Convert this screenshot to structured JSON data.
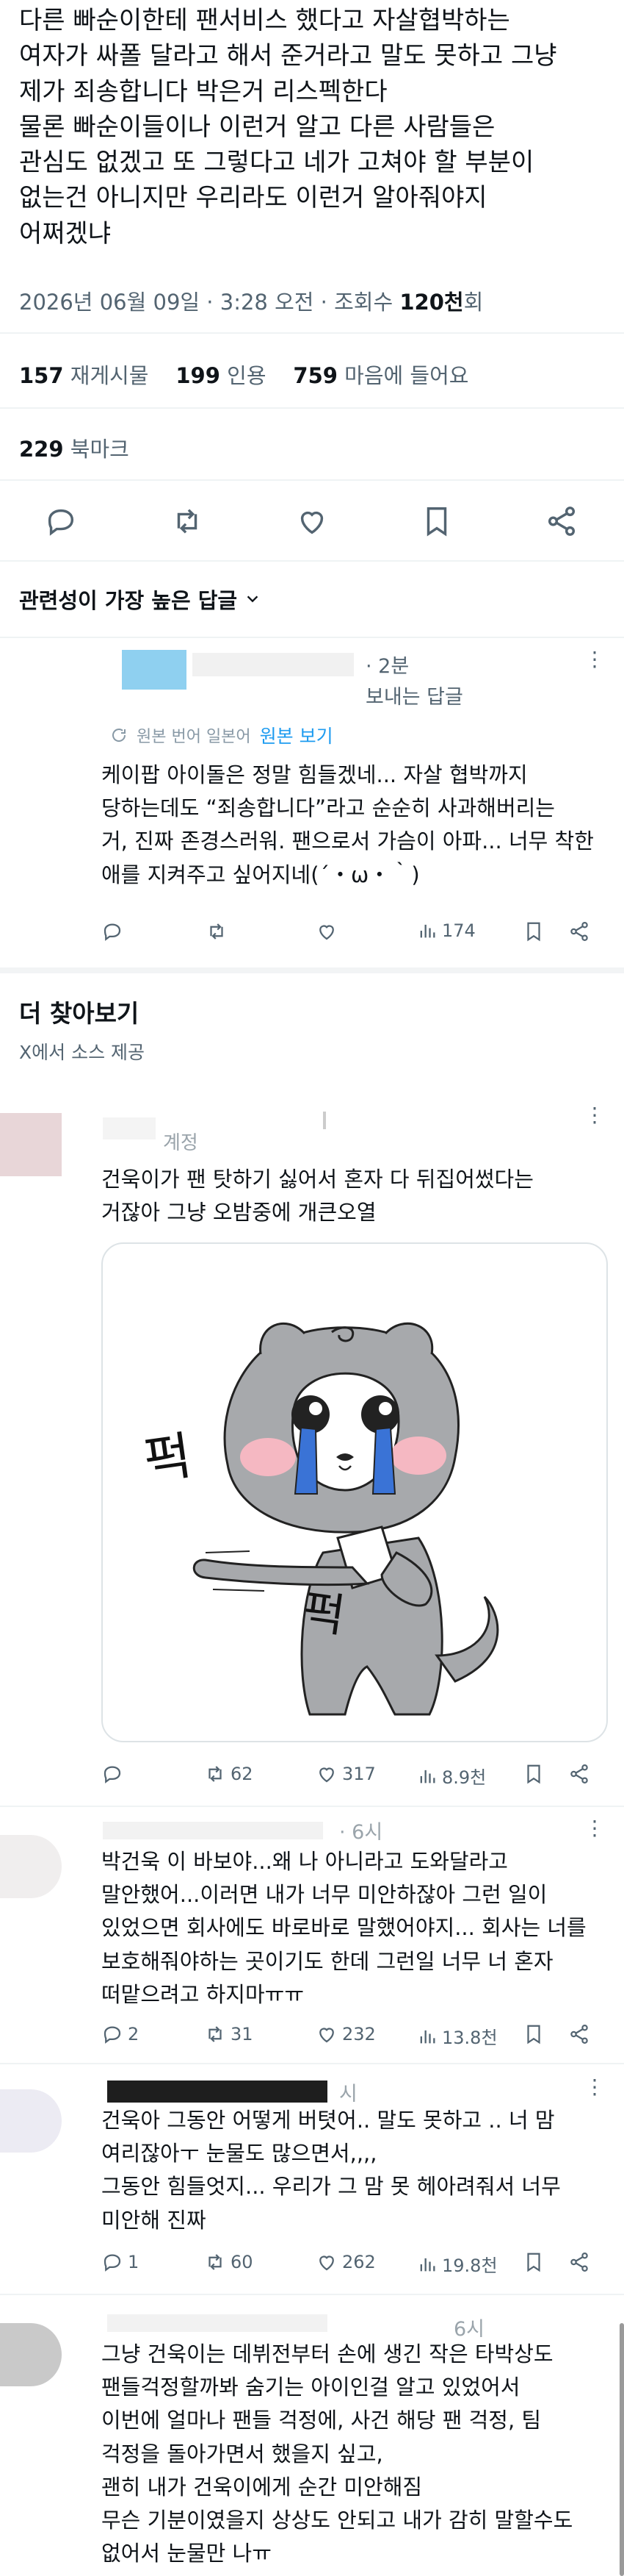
{
  "tweet": {
    "lines": [
      "다른 빠순이한테 팬서비스 했다고 자살협박하는",
      "여자가 싸폴 달라고 해서 준거라고 말도 못하고 그냥",
      "제가 죄송합니다 박은거 리스펙한다",
      "물론 빠순이들이나 이런거 알고 다른 사람들은",
      "관심도 없겠고 또 그렇다고 네가 고쳐야 할 부분이",
      "없는건 아니지만 우리라도 이런거 알아줘야지",
      "어쩌겠냐"
    ],
    "meta_time": "2026년 06월 09일 · 3:28 오전 · 조회수 ",
    "views": "120천",
    "views_suffix": "회",
    "reposts": "157",
    "reposts_label": "재게시물",
    "quotes": "199",
    "quotes_label": "인용",
    "likes": "759",
    "likes_label": "마음에 들어요",
    "bookmarks": "229",
    "bookmarks_label": "북마크"
  },
  "replies_sort": "관련성이 가장 높은 답글",
  "first_reply": {
    "time": "· 2분",
    "reply_to": "보내는 답글",
    "translated": "원본 번어 일본어",
    "show_original": "원본 보기",
    "lines": [
      "케이팝 아이돌은 정말 힘들겠네... 자살 협박까지",
      "당하는데도 “죄송합니다”라고 순순히 사과해버리는",
      "거, 진짜 존경스러워. 팬으로서 가슴이 아파... 너무 착한",
      "애를 지켜주고 싶어지네(´・ω・｀)"
    ],
    "views": "174"
  },
  "explore": {
    "title": "더 찾아보기",
    "source": "X에서 소스 제공"
  },
  "posts": [
    {
      "time": "계정",
      "lines": [
        "건욱이가 팬 탓하기 싫어서 혼자 다 뒤집어썼다는",
        "거잖아 그냥 오밤중에 개큰오열"
      ],
      "image_text": [
        "퍽",
        "퍽"
      ],
      "replies": "",
      "reposts": "62",
      "likes": "317",
      "views": "8.9천"
    },
    {
      "time": "· 6시",
      "lines": [
        "박건욱 이 바보야...왜 나 아니라고 도와달라고",
        "말안했어...이러면 내가 너무 미안하잖아 그런 일이",
        "있었으면 회사에도 바로바로 말했어야지... 회사는 너를",
        "보호해줘야하는 곳이기도 한데 그런일 너무 너 혼자",
        "떠맡으려고 하지마ㅠㅠ"
      ],
      "replies": "2",
      "reposts": "31",
      "likes": "232",
      "views": "13.8천"
    },
    {
      "time": "시",
      "lines": [
        "건욱아 그동안 어떻게 버텻어.. 말도 못하고 .. 너 맘",
        "여리잖아ㅜ 눈물도 많으면서,,,,",
        "그동안 힘들엇지... 우리가 그 맘 못 헤아려줘서 너무",
        "미안해 진짜"
      ],
      "replies": "1",
      "reposts": "60",
      "likes": "262",
      "views": "19.8천"
    },
    {
      "time": "6시",
      "lines": [
        "그냥 건욱이는 데뷔전부터 손에 생긴 작은 타박상도",
        "팬들걱정할까봐 숨기는 아이인걸 알고 있었어서",
        "이번에 얼마나 팬들 걱정에, 사건 해당 팬 걱정, 팀",
        "걱정을 돌아가면서 했을지 싶고,",
        "괜히 내가 건욱이에게 순간 미안해짐",
        "무슨 기분이였을지 상상도 안되고 내가 감히 말할수도",
        "없어서 눈물만 나ㅠ"
      ]
    }
  ],
  "colors": {
    "text": "#0f1419",
    "secondary": "#536471",
    "link": "#1d9bf0",
    "divider": "#eff3f4",
    "avatar_blue": "#8fd0f0",
    "avatar_pink": "#e8d6d8"
  }
}
